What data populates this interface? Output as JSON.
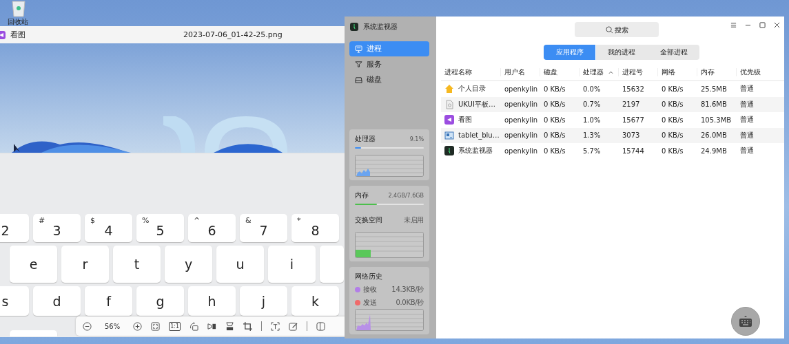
{
  "desktop": {
    "icons": [
      {
        "label": "回收站"
      }
    ]
  },
  "viewer": {
    "app_name": "看图",
    "file_name": "2023-07-06_01-42-25.png",
    "keyboard": {
      "rows": [
        [
          {
            "main": "2"
          },
          {
            "shift": "#",
            "main": "3"
          },
          {
            "shift": "$",
            "main": "4"
          },
          {
            "shift": "%",
            "main": "5"
          },
          {
            "shift": "^",
            "main": "6"
          },
          {
            "shift": "&",
            "main": "7"
          },
          {
            "shift": "*",
            "main": "8"
          }
        ],
        [
          {
            "main": "e"
          },
          {
            "main": "r"
          },
          {
            "main": "t"
          },
          {
            "main": "y"
          },
          {
            "main": "u"
          },
          {
            "main": "i"
          }
        ],
        [
          {
            "main": "s"
          },
          {
            "main": "d"
          },
          {
            "main": "f"
          },
          {
            "main": "g"
          },
          {
            "main": "h"
          },
          {
            "main": "j"
          },
          {
            "main": "k"
          }
        ]
      ]
    },
    "toolbar": {
      "zoom": "56%",
      "actual_size": "1:1"
    }
  },
  "monitor": {
    "title": "系统监视器",
    "nav": [
      {
        "label": "进程",
        "kind": "process",
        "selected": true
      },
      {
        "label": "服务",
        "kind": "service",
        "selected": false
      },
      {
        "label": "磁盘",
        "kind": "disk",
        "selected": false
      }
    ],
    "cpu": {
      "label": "处理器",
      "reading": "9.1%",
      "level": 0.091
    },
    "memory": {
      "label": "内存",
      "reading": "2.4GB/7.6GB",
      "level": 0.32
    },
    "swap": {
      "label": "交换空间",
      "reading": "未启用"
    },
    "network": {
      "title": "网络历史",
      "items": [
        {
          "label": "接收",
          "reading": "14.3KB/秒",
          "color": "#b27ee8"
        },
        {
          "label": "发送",
          "reading": "0.0KB/秒",
          "color": "#f06a6a"
        }
      ]
    },
    "search": {
      "placeholder": "搜索"
    },
    "tabs": [
      {
        "label": "应用程序",
        "selected": true
      },
      {
        "label": "我的进程",
        "selected": false
      },
      {
        "label": "全部进程",
        "selected": false
      }
    ],
    "table": {
      "columns": [
        {
          "label": "进程名称",
          "sorted": false
        },
        {
          "label": "用户名",
          "sorted": false
        },
        {
          "label": "磁盘",
          "sorted": false
        },
        {
          "label": "处理器",
          "sorted": true
        },
        {
          "label": "进程号",
          "sorted": false
        },
        {
          "label": "网络",
          "sorted": false
        },
        {
          "label": "内存",
          "sorted": false
        },
        {
          "label": "优先级",
          "sorted": false
        }
      ],
      "rows": [
        {
          "kind": "home",
          "cells": [
            "个人目录",
            "openkylin",
            "0 KB/s",
            "0.0%",
            "15632",
            "0 KB/s",
            "25.5MB",
            "普通"
          ]
        },
        {
          "kind": "file",
          "cells": [
            "UKUI平板…",
            "openkylin",
            "0 KB/s",
            "0.7%",
            "2197",
            "0 KB/s",
            "81.6MB",
            "普通"
          ]
        },
        {
          "kind": "viewer",
          "cells": [
            "看图",
            "openkylin",
            "0 KB/s",
            "1.0%",
            "15677",
            "0 KB/s",
            "105.3MB",
            "普通"
          ]
        },
        {
          "kind": "tablet",
          "cells": [
            "tablet_blu…",
            "openkylin",
            "0 KB/s",
            "1.3%",
            "3073",
            "0 KB/s",
            "26.0MB",
            "普通"
          ]
        },
        {
          "kind": "monitor",
          "cells": [
            "系统监视器",
            "openkylin",
            "0 KB/s",
            "5.7%",
            "15744",
            "0 KB/s",
            "24.9MB",
            "普通"
          ]
        }
      ]
    }
  }
}
